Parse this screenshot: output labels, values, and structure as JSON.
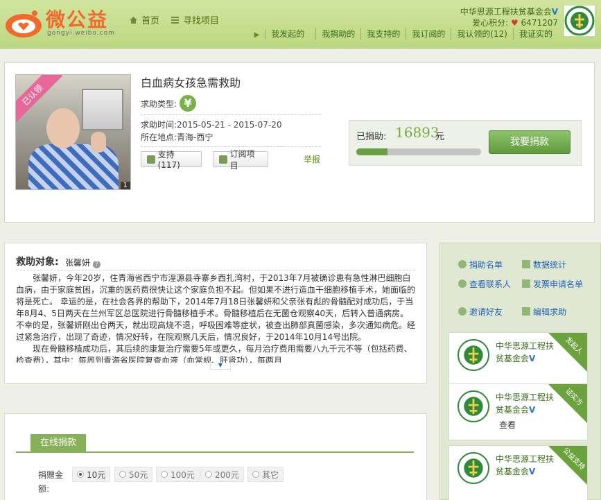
{
  "header": {
    "logo_text": "微公益",
    "logo_url_text": "gongyi.weibo.com",
    "nav": [
      {
        "label": "首页",
        "icon": "home-icon"
      },
      {
        "label": "寻找项目",
        "icon": "list-icon"
      }
    ],
    "org_name": "中华思源工程扶贫基金会",
    "points_label": "爱心积分:",
    "points_value": "6471207",
    "subnav": [
      "我发起的",
      "我捐助的",
      "我支持的",
      "我订阅的",
      "我认领的(12)",
      "我证实的"
    ]
  },
  "project": {
    "ribbon": "已认领",
    "image_count": "1",
    "title": "白血病女孩急需救助",
    "type_label": "求助类型:",
    "type_icon_glyph": "¥",
    "time_label": "求助时间",
    "time_value": ":2015-05-21 - 2015-07-20",
    "place_label": "所在地点",
    "place_value": ":青海-西宁",
    "support_label": "支持(117)",
    "subscribe_label": "订阅项目",
    "report_label": "举报",
    "donated_label": "已捐助:",
    "donated_amount": "16893",
    "donated_unit": "元",
    "progress_fraction": 0.25,
    "donate_button": "我要捐款"
  },
  "description": {
    "heading": "救助对象:",
    "name": "张馨妍",
    "help_glyph": "?",
    "paragraph1": "张馨妍，今年20岁，住青海省西宁市湟源县寺寨乡西扎湾村，于2013年7月被确诊患有急性淋巴细胞白血病，由于家庭贫困，沉重的医药费很快让这个家庭负担不起。但如果不进行造血干细胞移植手术，她面临的将是死亡。        幸运的是，在社会各界的帮助下，2014年7月18日张馨妍和父亲张有彪的骨髓配对成功后，于当年8月4、5日两天在兰州军区总医院进行骨髓移植手术。骨髓移植后在无菌仓观察40天，后转入普通病房。不幸的是，张馨妍刚出仓两天，就出现高烧不退，呼吸困难等症状，被查出肺部真菌感染，多次通知病危。经过紧急治疗，出现了奇迹，情况好转，在院观察几天后，情况良好，于2014年10月14号出院。",
    "paragraph2": "现在骨髓移植成功后，其后续的康复治疗需要5年或更久，每月治疗费用需要八九千元不等（包括药费、检查费），其中：每周到青海省医院复查血液（血常规、肝肾功），每两月"
  },
  "online": {
    "tab_label": "在线捐款",
    "amount_label": "捐赠金额:",
    "options": [
      "10元",
      "50元",
      "100元",
      "200元",
      "其它"
    ],
    "selected_option": "10元"
  },
  "sidebar": {
    "links": [
      {
        "label": "捐助名单"
      },
      {
        "label": "数据统计"
      },
      {
        "label": "查看联系人"
      },
      {
        "label": "发票申请名单"
      },
      {
        "label": "邀请好友"
      },
      {
        "label": "编辑求助"
      }
    ],
    "cards": [
      {
        "name": "中华思源工程扶贫基金会",
        "corner": "发起人",
        "sub": ""
      },
      {
        "name": "中华思源工程扶贫基金会",
        "corner": "证实方",
        "sub": "查看"
      },
      {
        "name": "中华思源工程扶贫基金会",
        "corner": "公益支持",
        "sub": ""
      }
    ]
  },
  "colors": {
    "header_green": "#c7df8f",
    "accent_green": "#6a9e45",
    "link_blue": "#1e63b6",
    "ribbon_pink": "#e76897"
  }
}
